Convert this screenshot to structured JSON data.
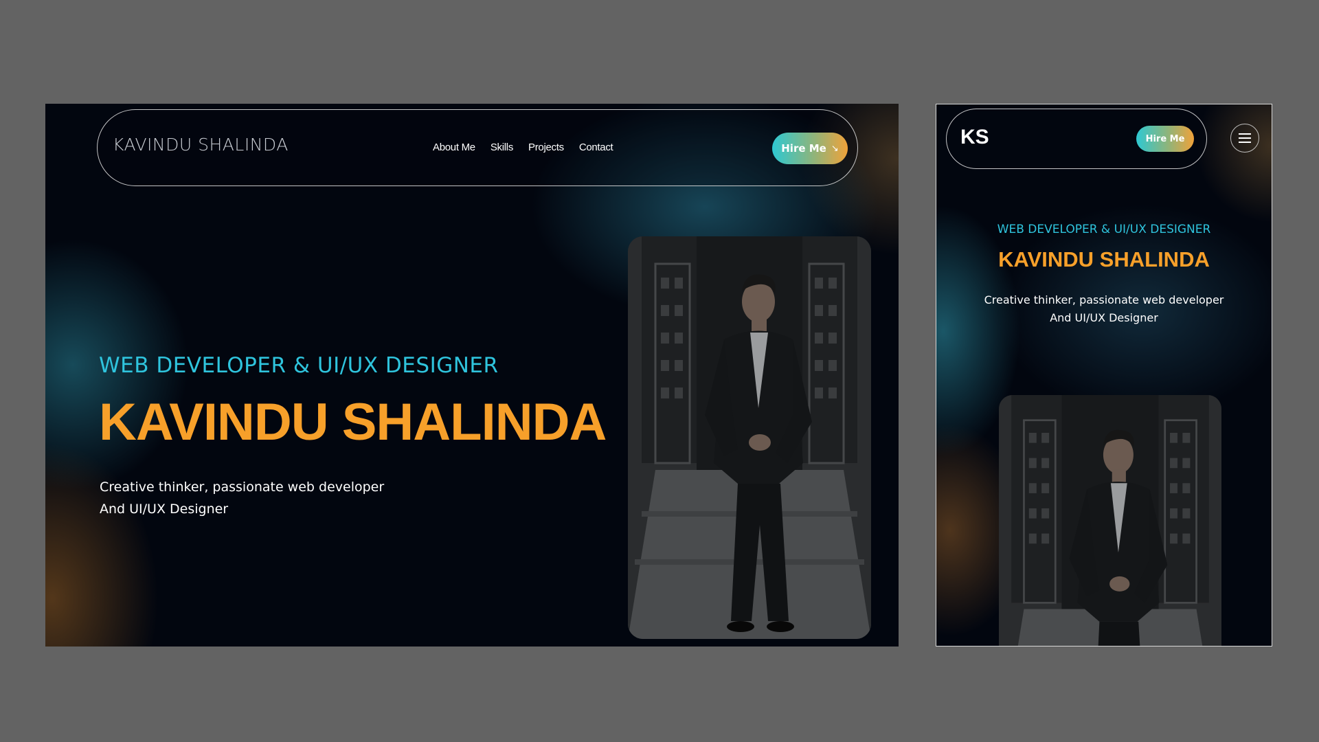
{
  "desktop": {
    "logo": "KAVINDU SHALINDA",
    "nav": {
      "items": [
        "About Me",
        "Skills",
        "Projects",
        "Contact"
      ],
      "hire_label": "Hire Me",
      "hire_icon": "arrow-down-right-icon"
    },
    "hero": {
      "role": "WEB DEVELOPER & UI/UX DESIGNER",
      "name": "KAVINDU SHALINDA",
      "desc_line1": "Creative thinker, passionate web developer",
      "desc_line2": "And UI/UX Designer"
    }
  },
  "mobile": {
    "logo": "KS",
    "hire_label": "Hire Me",
    "menu_icon": "hamburger-menu-icon",
    "hero": {
      "role": "WEB DEVELOPER & UI/UX DESIGNER",
      "name": "KAVINDU SHALINDA",
      "desc_line1": "Creative thinker, passionate web developer",
      "desc_line2": "And UI/UX Designer"
    }
  },
  "colors": {
    "background": "#02060f",
    "accent_cyan": "#2fc4dd",
    "accent_orange": "#f7a02a",
    "canvas": "#636363"
  }
}
